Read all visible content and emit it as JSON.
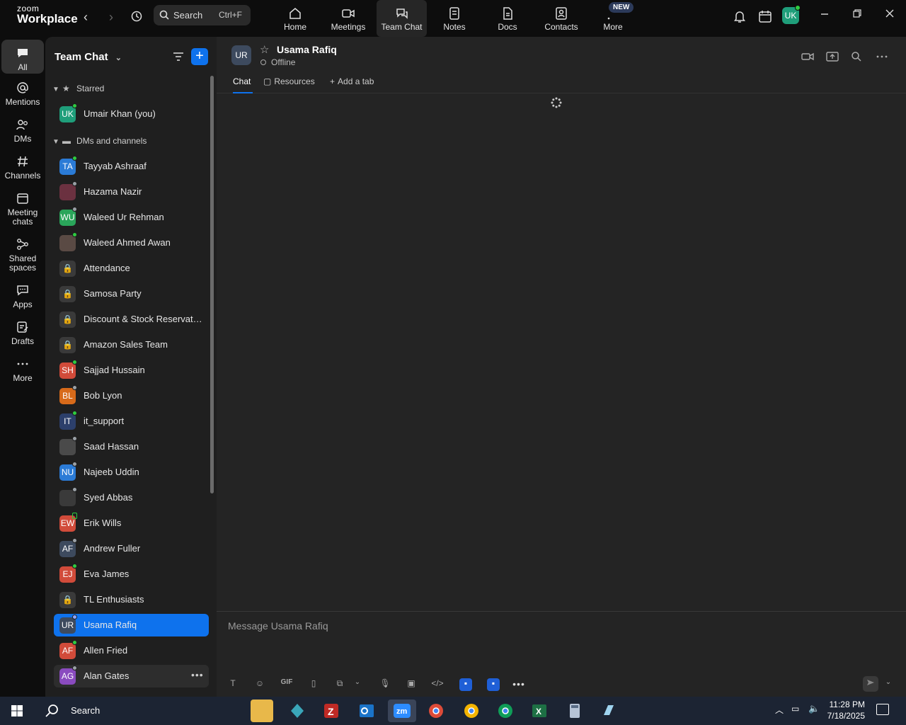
{
  "app": {
    "logo_top": "zoom",
    "logo_bottom": "Workplace"
  },
  "topbar": {
    "search_label": "Search",
    "search_shortcut": "Ctrl+F",
    "tabs": [
      {
        "label": "Home"
      },
      {
        "label": "Meetings"
      },
      {
        "label": "Team Chat"
      },
      {
        "label": "Notes"
      },
      {
        "label": "Docs"
      },
      {
        "label": "Contacts"
      },
      {
        "label": "More"
      }
    ],
    "new_badge": "NEW",
    "user_initials": "UK"
  },
  "rail": {
    "items": [
      {
        "label": "All"
      },
      {
        "label": "Mentions"
      },
      {
        "label": "DMs"
      },
      {
        "label": "Channels"
      },
      {
        "label": "Meeting chats"
      },
      {
        "label": "Shared spaces"
      },
      {
        "label": "Apps"
      },
      {
        "label": "Drafts"
      },
      {
        "label": "More"
      }
    ]
  },
  "sidebar": {
    "title": "Team Chat",
    "sections": {
      "starred": "Starred",
      "dms": "DMs and channels"
    },
    "starred": [
      {
        "initials": "UK",
        "name": "Umair Khan (you)",
        "color": "#1f9e7a",
        "status": "online"
      }
    ],
    "rows": [
      {
        "initials": "TA",
        "name": "Tayyab Ashraaf",
        "color": "#2b7bd6",
        "status": "online"
      },
      {
        "initials": "",
        "name": "Hazama Nazir",
        "color": "#6b3140",
        "status": "away"
      },
      {
        "initials": "WU",
        "name": "Waleed Ur Rehman",
        "color": "#2aa55a",
        "status": "away"
      },
      {
        "initials": "",
        "name": "Waleed Ahmed Awan",
        "color": "#5a4a44",
        "status": "online"
      },
      {
        "lock": true,
        "name": "Attendance"
      },
      {
        "lock": true,
        "name": "Samosa Party"
      },
      {
        "lock": true,
        "name": "Discount & Stock Reservati..."
      },
      {
        "lock": true,
        "name": "Amazon Sales Team"
      },
      {
        "initials": "SH",
        "name": "Sajjad Hussain",
        "color": "#d14b3a",
        "status": "online"
      },
      {
        "initials": "BL",
        "name": "Bob Lyon",
        "color": "#d76a1a",
        "status": "away"
      },
      {
        "initials": "IT",
        "name": "it_support",
        "color": "#2c3f6b",
        "status": "online"
      },
      {
        "initials": "",
        "name": "Saad Hassan",
        "color": "#4a4a4a",
        "status": "away"
      },
      {
        "initials": "NU",
        "name": "Najeeb Uddin",
        "color": "#2b7bd6",
        "status": "away"
      },
      {
        "initials": "",
        "name": "Syed Abbas",
        "color": "#3a3a3a",
        "status": "away"
      },
      {
        "initials": "EW",
        "name": "Erik Wills",
        "color": "#d14b3a",
        "status": "mobile"
      },
      {
        "initials": "AF",
        "name": "Andrew Fuller",
        "color": "#3d4a5e",
        "status": "away"
      },
      {
        "initials": "EJ",
        "name": "Eva James",
        "color": "#d14b3a",
        "status": "online"
      },
      {
        "lock": true,
        "name": "TL Enthusiasts"
      },
      {
        "initials": "UR",
        "name": "Usama Rafiq",
        "color": "#3d4a5e",
        "status": "offline",
        "selected": true
      },
      {
        "initials": "AF",
        "name": "Allen Fried",
        "color": "#d14b3a",
        "status": "online"
      },
      {
        "initials": "AG",
        "name": "Alan Gates",
        "color": "#8a4bbf",
        "status": "away",
        "hover": true
      }
    ]
  },
  "chat": {
    "initials": "UR",
    "name": "Usama Rafiq",
    "status": "Offline",
    "tabs": {
      "chat": "Chat",
      "resources": "Resources",
      "add": "Add a tab"
    },
    "placeholder": "Message Usama Rafiq",
    "gif_label": "GIF"
  },
  "taskbar": {
    "search_label": "Search",
    "time": "11:28 PM",
    "date": "7/18/2025"
  },
  "colors": {
    "accent": "#0e72ed",
    "online": "#2ecc40",
    "away": "#9aa0a6"
  }
}
